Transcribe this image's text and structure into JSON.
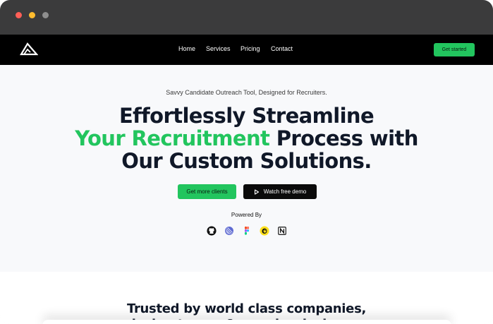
{
  "navbar": {
    "links": [
      "Home",
      "Services",
      "Pricing",
      "Contact"
    ],
    "cta_label": "Get started"
  },
  "hero": {
    "tagline": "Savvy Candidate Outreach Tool, Designed for Recruiters.",
    "headline_line1": "Effortlessly Streamline",
    "headline_accent": "Your Recruitment",
    "headline_line2_rest": " Process with",
    "headline_line3": "Our Custom Solutions.",
    "primary_cta": "Get more clients",
    "secondary_cta": "Watch free demo",
    "powered_by": "Powered By",
    "powered_icons": [
      "github-icon",
      "linear-icon",
      "figma-icon",
      "mailchimp-icon",
      "notion-icon"
    ]
  },
  "trusted": {
    "line1": "Trusted by world class companies,",
    "line2": "design teams & popular designers"
  },
  "colors": {
    "accent": "#22c55e",
    "dark": "#101828",
    "titlebar": "#3b3b3c",
    "nav_bg": "#000000"
  }
}
